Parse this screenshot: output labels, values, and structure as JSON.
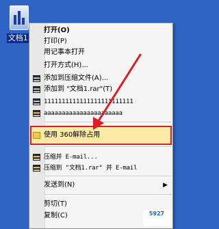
{
  "desktop": {
    "file_label": "文档1."
  },
  "menu": {
    "items": [
      {
        "label": "打开(O)"
      },
      {
        "label": "打印(P)"
      },
      {
        "label": "用记事本打开"
      },
      {
        "label": "打开方式(H)..."
      },
      {
        "label": "添加到压缩文件(A)..."
      },
      {
        "label": "添加到 \"文档1.rar\"(T)"
      },
      {
        "label": "1111111111111111111111111"
      },
      {
        "label": "aaaaaaaaaaaaaaaaaaaaaa"
      },
      {
        "label": "使用 360解除占用"
      },
      {
        "label": "压缩并 E-mail..."
      },
      {
        "label": "压缩到 \"文档1.rar\" 并 E-mail"
      },
      {
        "label": "发送到(N)"
      },
      {
        "label": "剪切(T)"
      },
      {
        "label": "复制(C)"
      }
    ],
    "submenu_arrow": "▶"
  },
  "annotation": {
    "color": "#e11b22"
  },
  "watermark": {
    "line1": "5927",
    "line2": ""
  }
}
